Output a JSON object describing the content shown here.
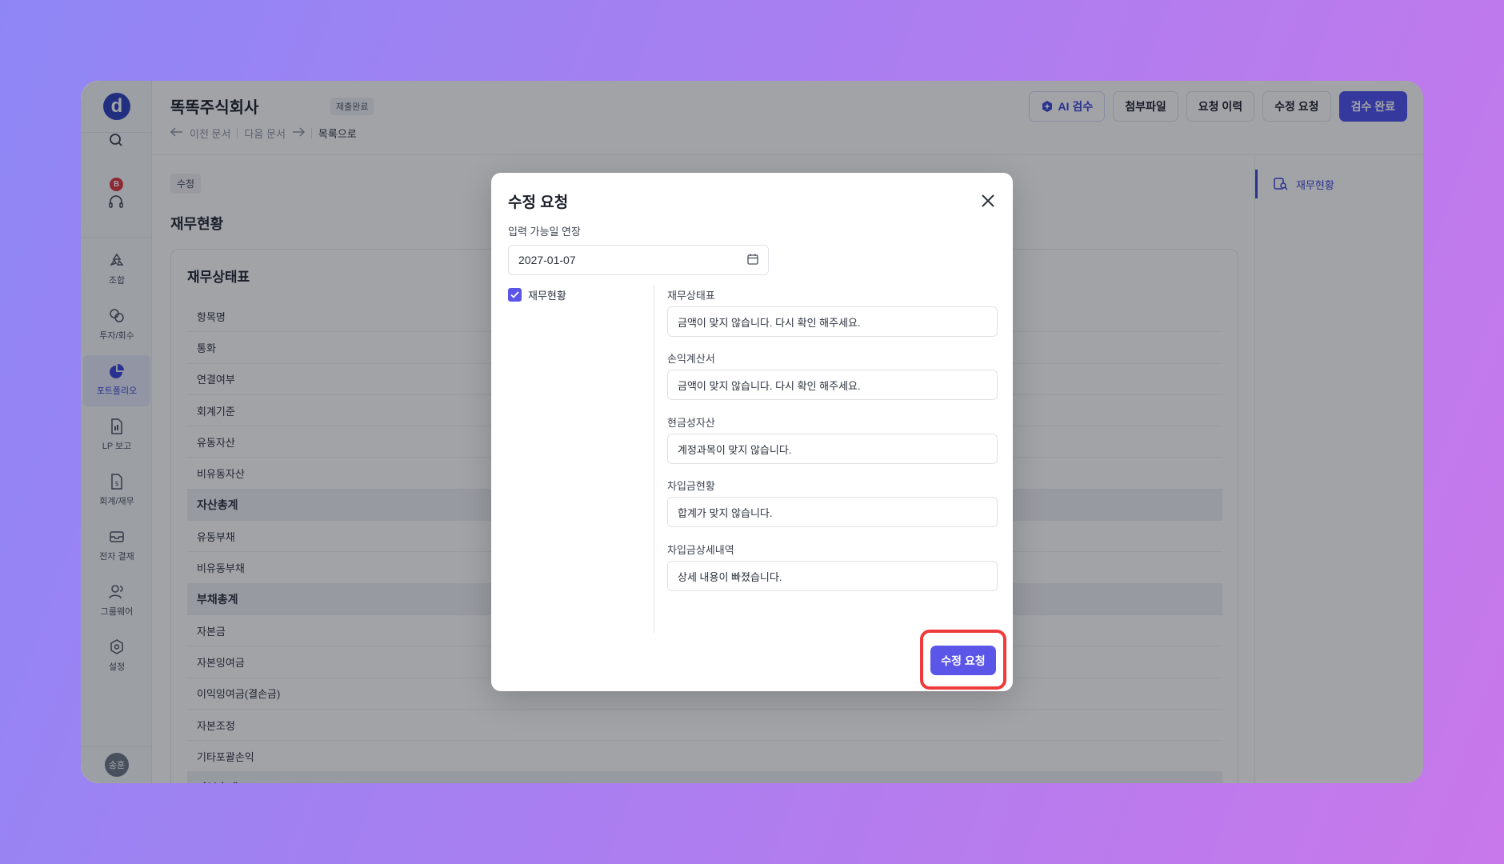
{
  "header": {
    "company": "똑똑주식회사",
    "status_badge": "제출완료",
    "prev_doc": "이전 문서",
    "next_doc": "다음 문서",
    "to_list": "목록으로",
    "buttons": {
      "ai_review": "AI 검수",
      "attachments": "첨부파일",
      "request_history": "요청 이력",
      "revision_request": "수정 요청",
      "review_complete": "검수 완료"
    }
  },
  "sidebar": {
    "badge": "B",
    "items": [
      {
        "label": "조합",
        "icon": "recycle-icon"
      },
      {
        "label": "투자/회수",
        "icon": "coins-icon"
      },
      {
        "label": "포트폴리오",
        "icon": "pie-chart-icon",
        "active": true
      },
      {
        "label": "LP 보고",
        "icon": "report-file-icon"
      },
      {
        "label": "회계/재무",
        "icon": "finance-file-icon"
      },
      {
        "label": "전자 결재",
        "icon": "inbox-icon"
      },
      {
        "label": "그룹웨어",
        "icon": "users-icon"
      },
      {
        "label": "설정",
        "icon": "settings-icon"
      }
    ],
    "avatar": "송훈"
  },
  "main": {
    "chip": "수정",
    "section_title": "재무현황",
    "card_title": "재무상태표",
    "rows": [
      {
        "label": "항목명",
        "total": false
      },
      {
        "label": "통화",
        "total": false
      },
      {
        "label": "연결여부",
        "total": false
      },
      {
        "label": "회계기준",
        "total": false
      },
      {
        "label": "유동자산",
        "total": false
      },
      {
        "label": "비유동자산",
        "total": false
      },
      {
        "label": "자산총계",
        "total": true
      },
      {
        "label": "유동부채",
        "total": false
      },
      {
        "label": "비유동부채",
        "total": false
      },
      {
        "label": "부채총계",
        "total": true
      },
      {
        "label": "자본금",
        "total": false
      },
      {
        "label": "자본잉여금",
        "total": false
      },
      {
        "label": "이익잉여금(결손금)",
        "total": false
      },
      {
        "label": "자본조정",
        "total": false
      },
      {
        "label": "기타포괄손익",
        "total": false
      },
      {
        "label": "자본총계",
        "total": true
      }
    ]
  },
  "right_panel": {
    "item": "재무현황"
  },
  "modal": {
    "title": "수정 요청",
    "date_label": "입력 가능일 연장",
    "date_value": "2027-01-07",
    "checkbox_label": "재무현황",
    "fields": [
      {
        "label": "재무상태표",
        "value": "금액이 맞지 않습니다. 다시 확인 해주세요."
      },
      {
        "label": "손익계산서",
        "value": "금액이 맞지 않습니다. 다시 확인 해주세요."
      },
      {
        "label": "현금성자산",
        "value": "계정과목이 맞지 않습니다."
      },
      {
        "label": "차입금현황",
        "value": "합계가 맞지 않습니다."
      },
      {
        "label": "차입금상세내역",
        "value": "상세 내용이 빠졌습니다."
      }
    ],
    "submit": "수정 요청"
  },
  "colors": {
    "primary": "#4b4ff0",
    "highlight": "#ee3b3b"
  }
}
